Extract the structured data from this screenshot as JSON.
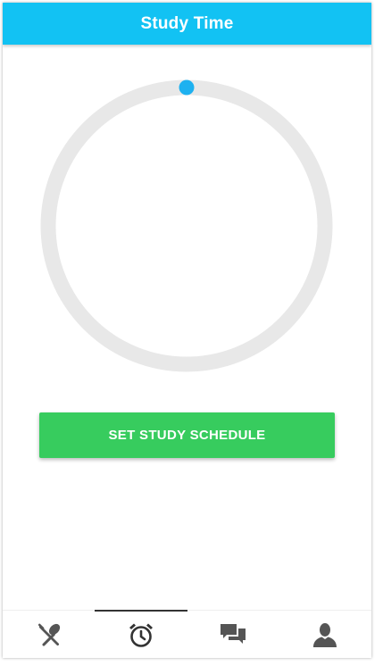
{
  "header": {
    "title": "Study Time"
  },
  "timer": {
    "progress": 0,
    "track_color": "#e8e8e8",
    "knob_color": "#1eb1f0"
  },
  "actions": {
    "set_schedule_label": "SET STUDY SCHEDULE"
  },
  "nav": {
    "active_index": 1,
    "items": [
      {
        "icon": "fork-spoon-icon"
      },
      {
        "icon": "alarm-clock-icon"
      },
      {
        "icon": "chat-bubbles-icon"
      },
      {
        "icon": "person-icon"
      }
    ]
  },
  "colors": {
    "header": "#12c2f3",
    "button": "#37cc5e",
    "nav_icon": "#555555"
  }
}
